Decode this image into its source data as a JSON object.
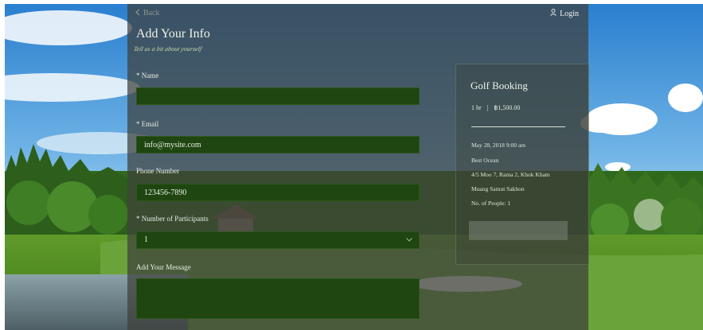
{
  "header": {
    "back_label": "Back",
    "login_label": "Login"
  },
  "form": {
    "title": "Add Your Info",
    "subtitle": "Tell us a bit about yourself",
    "name_label": "* Name",
    "name_value": "",
    "email_label": "* Email",
    "email_value": "info@mysite.com",
    "phone_label": "Phone Number",
    "phone_value": "123456-7890",
    "participants_label": "* Number of Participants",
    "participants_value": "1",
    "message_label": "Add Your Message",
    "message_value": ""
  },
  "booking": {
    "title": "Golf Booking",
    "duration": "1 hr",
    "separator": "|",
    "price": "฿1,500.00",
    "date_time": "May 28, 2018 9:00 am",
    "location_name": "Best Ocean",
    "address_line1": "4/5 Moo 7, Rama 2, Khok Kham",
    "address_line2": "Muang Samut Sakhon",
    "people": "No. of People: 1"
  },
  "icons": {
    "back": "chevron-left-icon",
    "login": "user-icon",
    "select": "chevron-down-icon"
  },
  "colors": {
    "field_bg": "#1f4511",
    "panel_overlay": "rgba(62,64,60,0.72)"
  }
}
